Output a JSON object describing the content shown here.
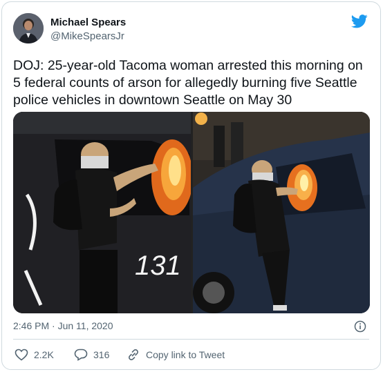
{
  "author": {
    "name": "Michael Spears",
    "handle": "@MikeSpearsJr"
  },
  "icons": {
    "brand": "twitter-bird-icon",
    "info": "info-icon",
    "like": "heart-icon",
    "reply": "reply-bubble-icon",
    "copy": "link-icon"
  },
  "tweet": {
    "text": "DOJ: 25-year-old Tacoma woman arrested this morning on 5 federal counts of arson for allegedly burning five Seattle police vehicles in downtown Seattle on May 30",
    "timestamp": "2:46 PM · Jun 11, 2020"
  },
  "media": {
    "left_car_graffiti": "131"
  },
  "actions": {
    "likes": "2.2K",
    "replies": "316",
    "copy_link": "Copy link to Tweet"
  },
  "colors": {
    "brand": "#1d9bf0",
    "secondary_text": "#536471",
    "border": "#cfd9de"
  }
}
